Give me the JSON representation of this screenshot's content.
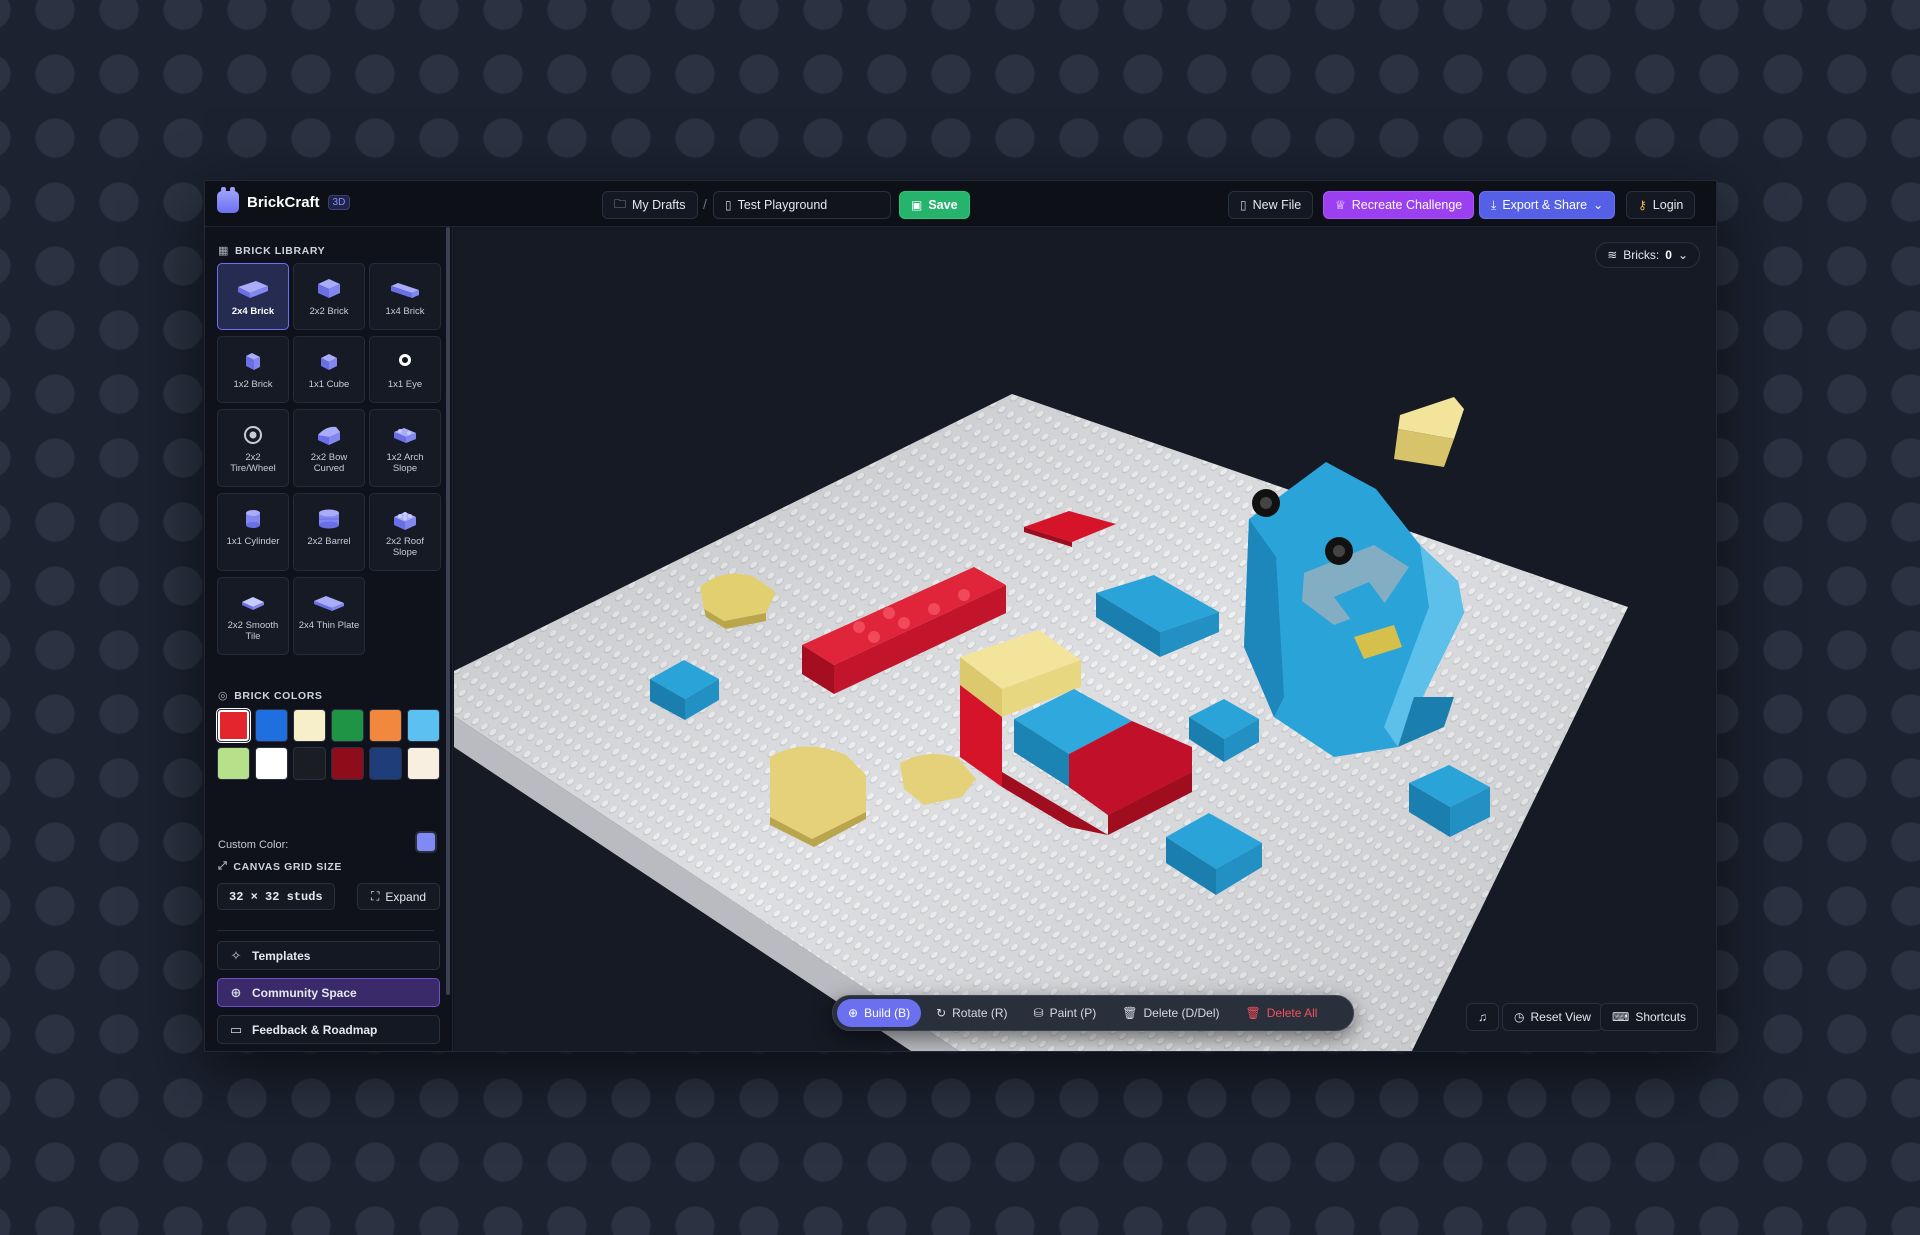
{
  "app": {
    "name": "BrickCraft",
    "badge": "3D"
  },
  "header": {
    "drafts_label": "My Drafts",
    "separator": "/",
    "project_name": "Test Playground",
    "save_label": "Save",
    "new_file_label": "New File",
    "recreate_label": "Recreate Challenge",
    "export_label": "Export & Share",
    "login_label": "Login"
  },
  "library": {
    "title": "BRICK LIBRARY",
    "items": [
      {
        "label": "2x4 Brick",
        "icon": "brick-2x4-icon"
      },
      {
        "label": "2x2 Brick",
        "icon": "brick-2x2-icon"
      },
      {
        "label": "1x4 Brick",
        "icon": "brick-1x4-icon"
      },
      {
        "label": "1x2 Brick",
        "icon": "brick-1x2-icon"
      },
      {
        "label": "1x1 Cube",
        "icon": "cube-1x1-icon"
      },
      {
        "label": "1x1 Eye",
        "icon": "eye-1x1-icon"
      },
      {
        "label": "2x2 Tire/Wheel",
        "icon": "wheel-icon"
      },
      {
        "label": "2x2 Bow Curved",
        "icon": "bow-curved-icon"
      },
      {
        "label": "1x2 Arch Slope",
        "icon": "arch-slope-icon"
      },
      {
        "label": "1x1 Cylinder",
        "icon": "cylinder-icon"
      },
      {
        "label": "2x2 Barrel",
        "icon": "barrel-icon"
      },
      {
        "label": "2x2 Roof Slope",
        "icon": "roof-slope-icon"
      },
      {
        "label": "2x2 Smooth Tile",
        "icon": "smooth-tile-icon"
      },
      {
        "label": "2x4 Thin Plate",
        "icon": "thin-plate-icon"
      }
    ],
    "selected": "2x4 Brick"
  },
  "colors": {
    "title": "BRICK COLORS",
    "swatches": [
      "#e3262d",
      "#1f6fe0",
      "#f7efc9",
      "#1f9445",
      "#f2883d",
      "#5cc0f0",
      "#b7e08a",
      "#ffffff",
      "#1a1d24",
      "#8e0c1b",
      "#1f3d78",
      "#f8efe0"
    ],
    "selected": "#e3262d",
    "custom_label": "Custom Color:",
    "custom_value": "#8189f5"
  },
  "grid": {
    "title": "CANVAS GRID SIZE",
    "size_label": "32 × 32 studs",
    "expand_label": "Expand"
  },
  "links": {
    "templates": "Templates",
    "community": "Community Space",
    "feedback": "Feedback & Roadmap"
  },
  "canvas": {
    "bricks_label": "Bricks:",
    "bricks_count": "0"
  },
  "toolbar": {
    "build": "Build (B)",
    "rotate": "Rotate (R)",
    "paint": "Paint (P)",
    "delete": "Delete (D/Del)",
    "delete_all": "Delete All"
  },
  "view": {
    "reset": "Reset View",
    "shortcuts": "Shortcuts"
  }
}
